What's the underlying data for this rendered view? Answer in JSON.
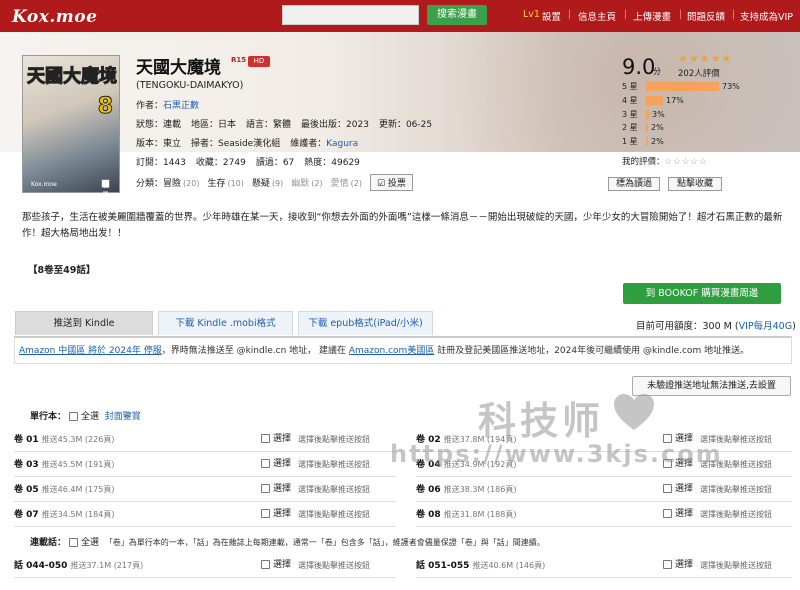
{
  "site": {
    "logo": "Kox.moe",
    "search_button": "搜索漫畫",
    "level": "Lv1",
    "nav": [
      "設置",
      "信息主頁",
      "上傳漫畫",
      "問題反饋",
      "支持成為VIP"
    ]
  },
  "manga": {
    "title": "天國大魔境",
    "r15": "R15",
    "hd": "HD",
    "original": "(TENGOKU-DAIMAKYO)",
    "author_label": "作者：",
    "author": "石黒正數",
    "status": "狀態：連載",
    "region": "地區：日本",
    "lang": "語言：繁體",
    "latest": "最後出版：2023",
    "updated": "更新：06-25",
    "edition": "版本：東立",
    "scanner": "掃者：Seaside漢化組",
    "maintainer_label": "維護者：",
    "maintainer": "Kagura",
    "subs": "訂閱：1443",
    "favs": "收藏：2749",
    "reads": "讀過：67",
    "hot": "熱度：49629",
    "cat_label": "分類：",
    "categories": [
      {
        "name": "冒險",
        "count": "(20)"
      },
      {
        "name": "生存",
        "count": "(10)"
      },
      {
        "name": "懸疑",
        "count": "(9)"
      },
      {
        "name": "幽默",
        "count": "(2)"
      },
      {
        "name": "愛情",
        "count": "(2)"
      }
    ],
    "vote_label": "☑ 投票",
    "cover_title": "天國大魔境",
    "cover_num": "8",
    "cover_author": "石黒正數",
    "cover_site": "Kox.moe"
  },
  "rating": {
    "score": "9.0",
    "unit": "分",
    "stars": "★★★★★",
    "people": "202人評價",
    "rows": [
      {
        "label": "5 星",
        "pct": 73,
        "text": "73%"
      },
      {
        "label": "4 星",
        "pct": 17,
        "text": "17%"
      },
      {
        "label": "3 星",
        "pct": 3,
        "text": "3%"
      },
      {
        "label": "2 星",
        "pct": 2,
        "text": "2%"
      },
      {
        "label": "1 星",
        "pct": 2,
        "text": "2%"
      }
    ],
    "my_label": "我的評價：",
    "my_stars": "☆☆☆☆☆",
    "btn_read": "標為讀過",
    "btn_fav": "點擊收藏"
  },
  "description": "那些孩子，生活在被美麗圍牆覆蓋的世界。少年時雄在某一天，接收到“你想去外面的外面嗎”這樣一條消息－－開始出現破綻的天國，少年少女的大冒險開始了！超才石黒正數的最新作！超大格局地出发！！",
  "range": "【8卷至49話】",
  "bookof": "到 BOOKOF 購買漫畫周邊",
  "tabs": [
    "推送到 Kindle",
    "下載 Kindle .mobi格式",
    "下載 epub格式(iPad/小米)"
  ],
  "quota": {
    "label": "目前可用額度：300 M",
    "vip": "VIP每月40G"
  },
  "notice": {
    "a1": "Amazon 中國區 將於 2024年 停服",
    "t1": "，界時無法推送至 @kindle.cn 地址，  建議在 ",
    "a2": "Amazon.com美國區",
    "t2": " 註冊及登記美國區推送地址，2024年後可繼續使用 @kindle.com 地址推送。"
  },
  "unverified_btn": "未驗證推送地址無法推送,去設置",
  "volumes": {
    "label": "單行本：",
    "all": "全選",
    "cover": "封面鑒賞",
    "items": [
      {
        "name": "卷 01",
        "info": "推送45.3M (226頁)"
      },
      {
        "name": "卷 02",
        "info": "推送37.8M (194頁)"
      },
      {
        "name": "卷 03",
        "info": "推送45.5M (191頁)"
      },
      {
        "name": "卷 04",
        "info": "推送34.9M (192頁)"
      },
      {
        "name": "卷 05",
        "info": "推送46.4M (175頁)"
      },
      {
        "name": "卷 06",
        "info": "推送38.3M (186頁)"
      },
      {
        "name": "卷 07",
        "info": "推送34.5M (184頁)"
      },
      {
        "name": "卷 08",
        "info": "推送31.8M (188頁)"
      }
    ]
  },
  "serial": {
    "label": "連載話：",
    "all": "全選",
    "note": "「卷」為單行本的一本，「話」為在雜誌上每期連載，通常一「卷」包含多「話」，維護者會儘量保證「卷」與「話」間連續。",
    "items": [
      {
        "name": "話 044-050",
        "info": "推送37.1M (217頁)"
      },
      {
        "name": "話 051-055",
        "info": "推送40.6M (146頁)"
      }
    ]
  },
  "select_label": "選擇",
  "select_hint": "選擇後點擊推送按鈕",
  "watermark": {
    "cn": "科技师",
    "url": "https://www.3kjs.com"
  }
}
